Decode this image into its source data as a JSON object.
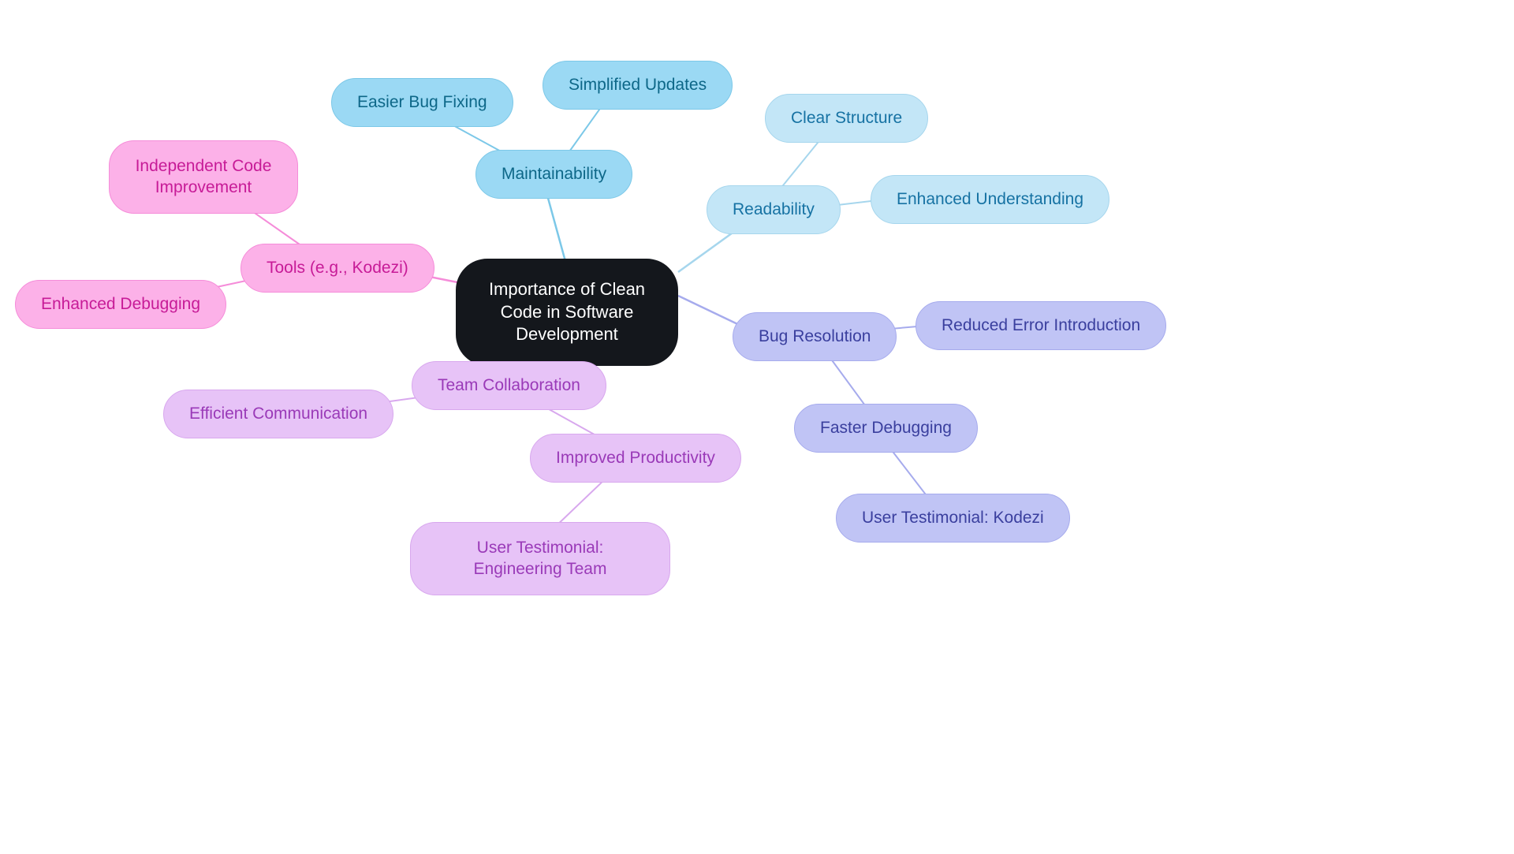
{
  "central": "Importance of Clean Code in Software Development",
  "branches": {
    "readability": {
      "label": "Readability",
      "children": {
        "clear_structure": "Clear Structure",
        "enhanced_understanding": "Enhanced Understanding"
      }
    },
    "maintainability": {
      "label": "Maintainability",
      "children": {
        "easier_bug_fixing": "Easier Bug Fixing",
        "simplified_updates": "Simplified Updates"
      }
    },
    "bug_resolution": {
      "label": "Bug Resolution",
      "children": {
        "reduced_error": "Reduced Error Introduction",
        "faster_debugging": "Faster Debugging",
        "testimonial_kodezi": "User Testimonial: Kodezi"
      }
    },
    "team_collaboration": {
      "label": "Team Collaboration",
      "children": {
        "efficient_communication": "Efficient Communication",
        "improved_productivity": "Improved Productivity",
        "testimonial_team": "User Testimonial: Engineering Team"
      }
    },
    "tools": {
      "label": "Tools (e.g., Kodezi)",
      "children": {
        "independent_improvement": "Independent Code Improvement",
        "enhanced_debugging": "Enhanced Debugging"
      }
    }
  }
}
